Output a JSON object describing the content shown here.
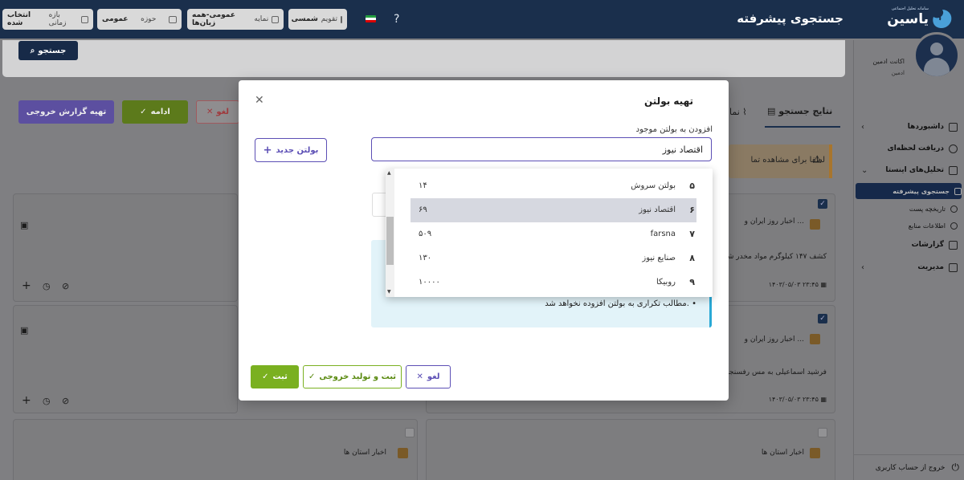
{
  "topbar": {
    "logo_name": "یاسین",
    "logo_tagline": "سامانه تحلیل اجتماعی",
    "page_title": "جستجوی پیشرفته",
    "help": "?",
    "calendar_label": "تقویم",
    "calendar_value": "شمسی",
    "display_label": "نمایه",
    "display_value": "عمومی-همه زبان‌ها",
    "domain_label": "حوزه",
    "domain_value": "عمومی",
    "period_label": "بازه زمانی",
    "period_value": "انتخاب شده"
  },
  "search": {
    "button_label": "جستجو"
  },
  "toolbar": {
    "report_label": "تهیه گزارش خروجی",
    "continue_label": "ادامه",
    "cancel_label": "لغو"
  },
  "tabs": {
    "results_label": "نتایج جستجو",
    "partial_label": "نما"
  },
  "warning": {
    "text": "لطفا برای مشاهده تما"
  },
  "cards": [
    {
      "source": "اخبار روز ایران و ...",
      "excerpt": "کشف ۱۴۷ کیلوگرم مواد مخدر شی",
      "date": "۱۴۰۳/۰۵/۰۳ ۲۳:۴۵"
    },
    {
      "source": "اخبار روز ایران و ...",
      "excerpt": "فرشید اسماعیلی به مس رفسنجان",
      "date": "۱۴۰۳/۰۵/۰۳ ۲۳:۴۵"
    },
    {
      "source": "اخبار استان ها"
    },
    {
      "source": "اخبار استان ها"
    }
  ],
  "sidebar": {
    "account_name": "اکانت ادمین",
    "account_role": "ادمین",
    "items": [
      {
        "label": "داشبوردها"
      },
      {
        "label": "دریافت لحظه‌ای"
      },
      {
        "label": "تحلیل‌های اینستا"
      },
      {
        "label": "جستجوی پیشرفته"
      },
      {
        "label": "تاریخچه پست"
      },
      {
        "label": "اطلاعات منابع"
      },
      {
        "label": "گزارشات"
      },
      {
        "label": "مدیریت"
      }
    ],
    "logout_label": "خروج از حساب کاربری"
  },
  "modal": {
    "title": "تهیه بولتن",
    "field_label": "افزودن به بولتن موجود",
    "input_value": "اقتصاد نیوز",
    "new_bulletin_label": "بولتن جدید",
    "info_text": "مطالب تکراری به بولتن افزوده نخواهد شد.",
    "save_label": "ثبت",
    "save_export_label": "ثبت و تولید خروجی",
    "cancel_label": "لغو"
  },
  "dropdown": {
    "options": [
      {
        "num": "۵",
        "name": "بولتن سروش",
        "count": "۱۴",
        "selected": false
      },
      {
        "num": "۶",
        "name": "اقتصاد نیوز",
        "count": "۶۹",
        "selected": true
      },
      {
        "num": "۷",
        "name": "farsna",
        "count": "۵۰۹",
        "selected": false
      },
      {
        "num": "۸",
        "name": "صنایع نیوز",
        "count": "۱۳۰",
        "selected": false
      },
      {
        "num": "۹",
        "name": "روبیکا",
        "count": "۱۰۰۰۰",
        "selected": false
      }
    ]
  },
  "colors": {
    "navy": "#1a2f4c",
    "purple": "#5c4fb5",
    "green": "#7ab020",
    "info_bg": "#e2f3f9"
  }
}
